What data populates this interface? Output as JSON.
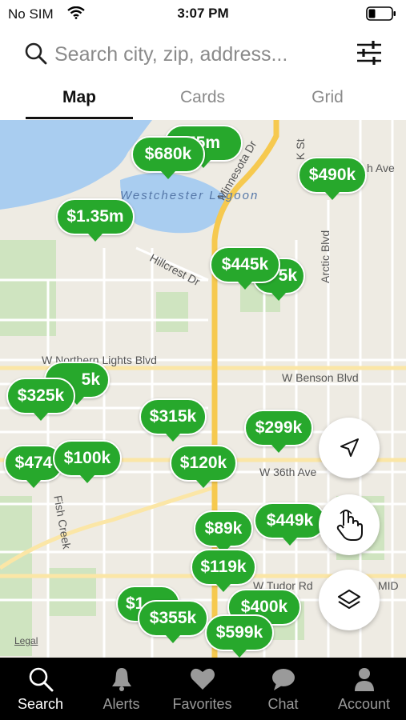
{
  "status_bar": {
    "carrier": "No SIM",
    "time": "3:07 PM"
  },
  "search": {
    "placeholder": "Search city, zip, address..."
  },
  "tabs": [
    {
      "label": "Map",
      "active": true
    },
    {
      "label": "Cards",
      "active": false
    },
    {
      "label": "Grid",
      "active": false
    }
  ],
  "map": {
    "labels": {
      "lagoon": "Westchester Lagoon",
      "minnesota": "Minnesota Dr",
      "hillcrest": "Hillcrest Dr",
      "northern_lights": "W Northern Lights Blvd",
      "benson": "W Benson Blvd",
      "arctic": "Arctic Blvd",
      "k_st": "K St",
      "th_ave": "h Ave",
      "w36": "W 36th Ave",
      "tudor": "W Tudor Rd",
      "fish_creek": "Fish Creek",
      "mid": "MID"
    },
    "legal": "Legal",
    "pins": [
      "$680k",
      "55m",
      "$490k",
      "$1.35m",
      "$445k",
      "5k",
      "$325k",
      "5k",
      "$315k",
      "$299k",
      "$474",
      "$100k",
      "$120k",
      "$89k",
      "$449k",
      "$119k",
      "$355k",
      "$400k",
      "$599k",
      "$1"
    ],
    "colors": {
      "pin": "#27a82c",
      "water": "#a9cdf0",
      "park": "#cfe4c0",
      "major_road": "#f6c94f"
    }
  },
  "nav": [
    {
      "label": "Search",
      "icon": "search-icon",
      "active": true
    },
    {
      "label": "Alerts",
      "icon": "bell-icon",
      "active": false
    },
    {
      "label": "Favorites",
      "icon": "heart-icon",
      "active": false
    },
    {
      "label": "Chat",
      "icon": "chat-icon",
      "active": false
    },
    {
      "label": "Account",
      "icon": "person-icon",
      "active": false
    }
  ]
}
